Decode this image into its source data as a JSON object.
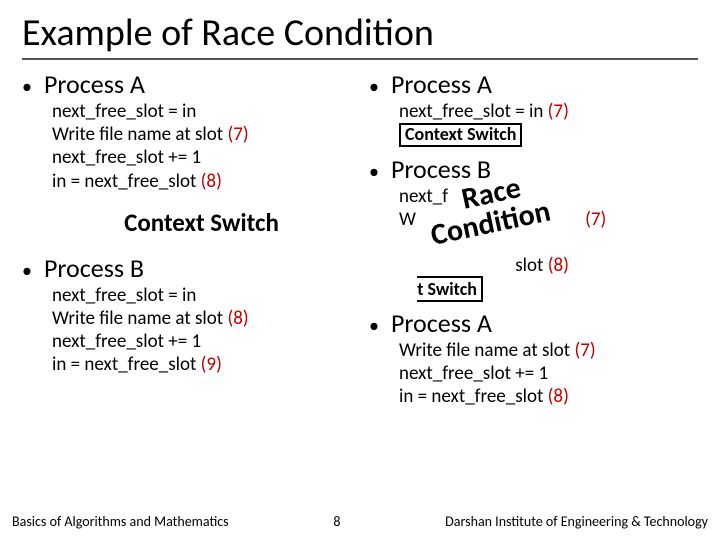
{
  "title": "Example of Race Condition",
  "left": {
    "procA": {
      "head": "Process A",
      "l1": "next_free_slot = in",
      "l2a": "Write file name at slot ",
      "l2b": "(7)",
      "l3": "next_free_slot += 1",
      "l4a": "in = next_free_slot ",
      "l4b": "(8)"
    },
    "ctx": "Context Switch",
    "procB": {
      "head": "Process B",
      "l1": "next_free_slot = in",
      "l2a": "Write file name at slot ",
      "l2b": "(8)",
      "l3": "next_free_slot += 1",
      "l4a": "in = next_free_slot ",
      "l4b": "(9)"
    }
  },
  "right": {
    "procA1": {
      "head": "Process A",
      "l1a": "next_free_slot = in ",
      "l1b": "(7)",
      "ctx": "Context Switch"
    },
    "procB": {
      "head": "Process B",
      "l1pre": "next_f",
      "l2pre": "W",
      "l2num": "(7)",
      "l4num": "(8)",
      "ctx": "Context Switch",
      "overlay": "  Race\nCondition"
    },
    "procA2": {
      "head": "Process A",
      "l1a": "Write file name at slot ",
      "l1b": "(7)",
      "l2": "next_free_slot += 1",
      "l3a": "in = next_free_slot ",
      "l3b": "(8)"
    }
  },
  "footer": {
    "left": "Basics of Algorithms and Mathematics",
    "page": "8",
    "right": "Darshan Institute of Engineering & Technology"
  }
}
